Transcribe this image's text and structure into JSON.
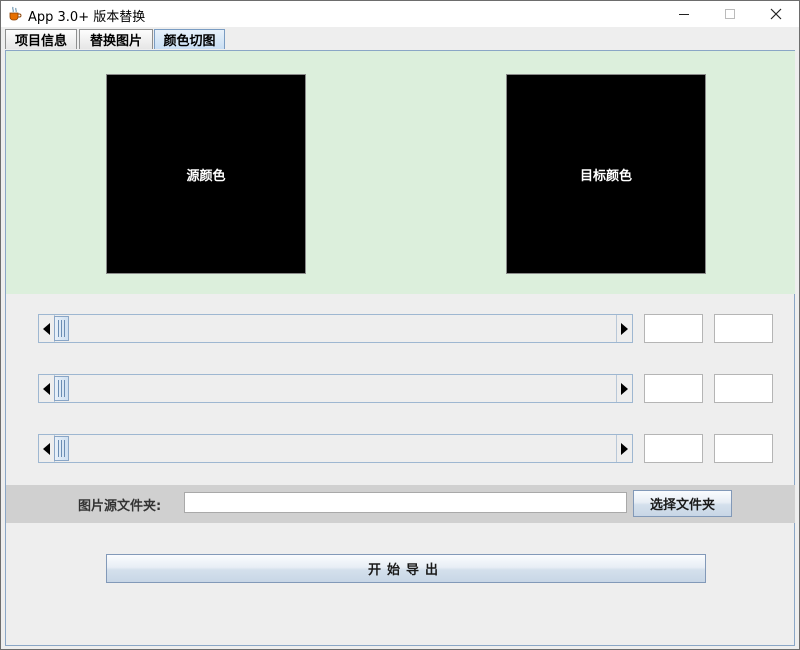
{
  "window": {
    "title": "App 3.0+ 版本替换",
    "controls": {
      "minimize": "—",
      "maximize": "☐",
      "close": "✕"
    }
  },
  "tabs": [
    {
      "label": "项目信息",
      "selected": false
    },
    {
      "label": "替换图片",
      "selected": false
    },
    {
      "label": "颜色切图",
      "selected": true
    }
  ],
  "preview": {
    "source_label": "源颜色",
    "target_label": "目标颜色",
    "source_color": "#000000",
    "target_color": "#000000",
    "panel_bg": "#dcefdc"
  },
  "sliders": [
    {
      "value_a": "",
      "value_b": "",
      "level": 0
    },
    {
      "value_a": "",
      "value_b": "",
      "level": 0
    },
    {
      "value_a": "",
      "value_b": "",
      "level": 0
    }
  ],
  "folder": {
    "label": "图片源文件夹:",
    "value": "",
    "choose_button": "选择文件夹"
  },
  "export_button": "开始导出"
}
